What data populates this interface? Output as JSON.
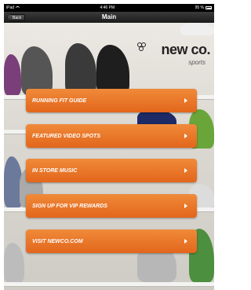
{
  "status_bar": {
    "carrier": "iPad",
    "time": "4:46 PM",
    "battery": "95 %"
  },
  "nav": {
    "back_label": "Back",
    "title": "Main"
  },
  "brand": {
    "name": "new co.",
    "tagline": "sports"
  },
  "menu": [
    {
      "label": "RUNNING FIT GUIDE"
    },
    {
      "label": "FEATURED VIDEO SPOTS"
    },
    {
      "label": "IN STORE MUSIC"
    },
    {
      "label": "SIGN UP FOR VIP REWARDS"
    },
    {
      "label": "VISIT NEWCO.COM"
    }
  ],
  "colors": {
    "button_orange": "#e97a2c",
    "nav_dark": "#2a2a2a"
  },
  "icons": {
    "wifi": "wifi-icon",
    "battery": "battery-icon",
    "chevron": "chevron-right-icon"
  }
}
